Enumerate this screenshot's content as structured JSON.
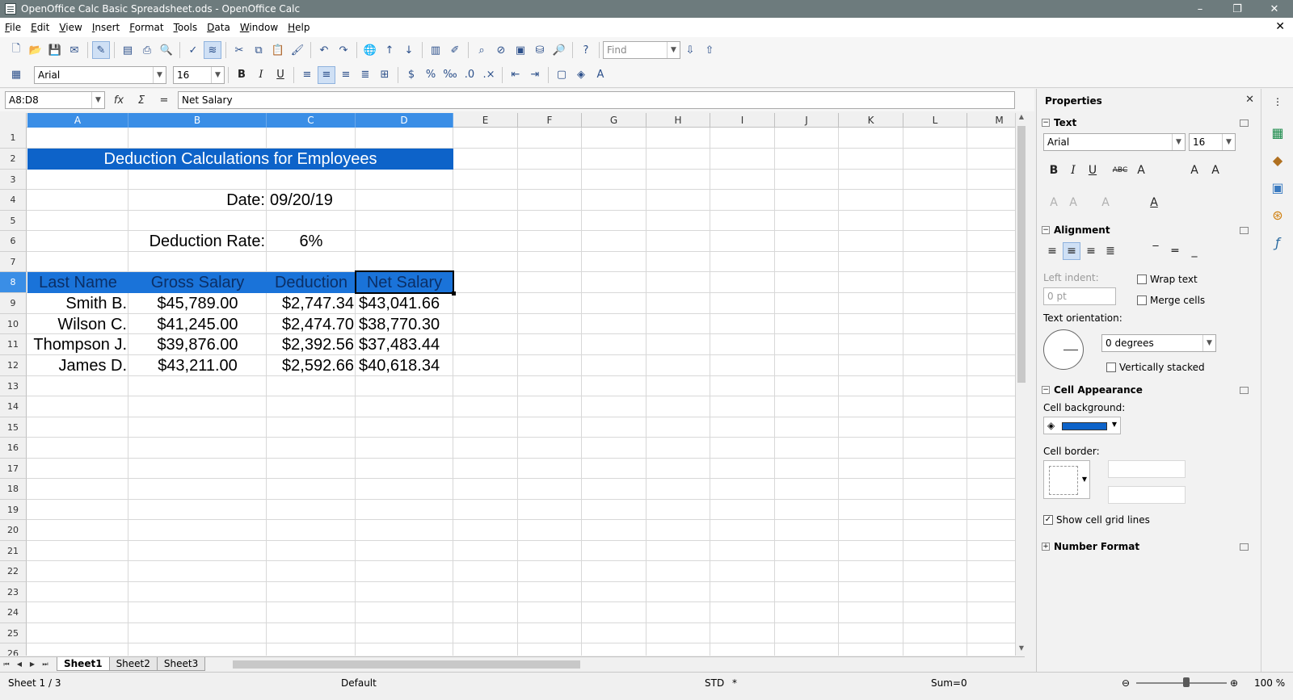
{
  "window": {
    "title": "OpenOffice Calc Basic Spreadsheet.ods - OpenOffice Calc",
    "minimize": "–",
    "restore": "❐",
    "close": "✕"
  },
  "menu": [
    "File",
    "Edit",
    "View",
    "Insert",
    "Format",
    "Tools",
    "Data",
    "Window",
    "Help"
  ],
  "doc_close": "✕",
  "toolbar1": {
    "find_placeholder": "Find"
  },
  "toolbar2": {
    "font_name": "Arial",
    "font_size": "16",
    "bold": "B",
    "italic": "I",
    "underline": "U"
  },
  "formula_bar": {
    "name_box": "A8:D8",
    "fx": "fx",
    "sum": "Σ",
    "equals": "=",
    "content": "Net Salary"
  },
  "columns": [
    "A",
    "B",
    "C",
    "D",
    "E",
    "F",
    "G",
    "H",
    "I",
    "J",
    "K",
    "L",
    "M"
  ],
  "rows": [
    "1",
    "2",
    "3",
    "4",
    "5",
    "6",
    "7",
    "8",
    "9",
    "10",
    "11",
    "12",
    "13",
    "14",
    "15",
    "16",
    "17",
    "18",
    "19",
    "20",
    "21",
    "22",
    "23",
    "24",
    "25",
    "26"
  ],
  "sheet": {
    "title": "Deduction Calculations for Employees",
    "date_label": "Date:",
    "date_value": "09/20/19",
    "rate_label": "Deduction Rate:",
    "rate_value": "6%",
    "headers": [
      "Last Name",
      "Gross Salary",
      "Deduction",
      "Net Salary"
    ],
    "data": [
      [
        "Smith B.",
        "$45,789.00",
        "$2,747.34",
        "$43,041.66"
      ],
      [
        "Wilson C.",
        "$41,245.00",
        "$2,474.70",
        "$38,770.30"
      ],
      [
        "Thompson J.",
        "$39,876.00",
        "$2,392.56",
        "$37,483.44"
      ],
      [
        "James D.",
        "$43,211.00",
        "$2,592.66",
        "$40,618.34"
      ]
    ]
  },
  "tabs": [
    "Sheet1",
    "Sheet2",
    "Sheet3"
  ],
  "status": {
    "sheet": "Sheet 1 / 3",
    "style": "Default",
    "mode": "STD",
    "modified": "*",
    "sum": "Sum=0",
    "zoom": "100 %"
  },
  "sidebar": {
    "title": "Properties",
    "close": "✕",
    "text_section": "Text",
    "font_name": "Arial",
    "font_size": "16",
    "alignment_section": "Alignment",
    "left_indent_label": "Left indent:",
    "left_indent_value": "0 pt",
    "wrap_text": "Wrap text",
    "merge_cells": "Merge cells",
    "text_orientation_label": "Text orientation:",
    "orientation_value": "0 degrees",
    "vertically_stacked": "Vertically stacked",
    "cell_appearance_section": "Cell Appearance",
    "cell_background_label": "Cell background:",
    "cell_border_label": "Cell border:",
    "show_grid_lines": "Show cell grid lines",
    "number_format_section": "Number Format"
  },
  "colors": {
    "title_band": "#0d63c9",
    "header_band": "#1a73d9",
    "selection": "#3a8ee6",
    "titlebar": "#6d7b7d"
  }
}
